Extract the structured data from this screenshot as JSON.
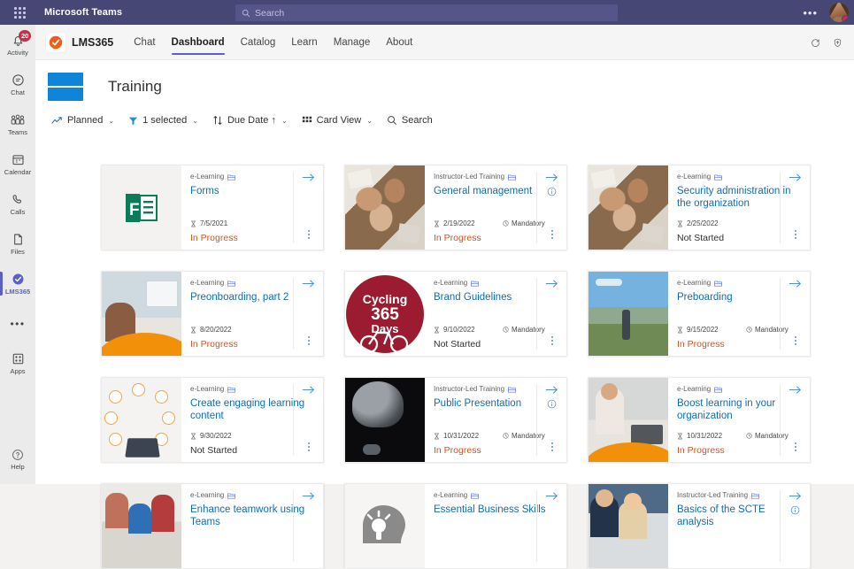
{
  "topbar": {
    "app_title": "Microsoft Teams",
    "search_placeholder": "Search",
    "search_value": "",
    "more_label": "•••"
  },
  "rail": {
    "items": [
      {
        "label": "Activity",
        "icon": "activity-bell-icon",
        "badge": "20"
      },
      {
        "label": "Chat",
        "icon": "chat-bubble-icon",
        "badge": ""
      },
      {
        "label": "Teams",
        "icon": "teams-people-icon",
        "badge": ""
      },
      {
        "label": "Calendar",
        "icon": "calendar-icon",
        "badge": ""
      },
      {
        "label": "Calls",
        "icon": "phone-icon",
        "badge": ""
      },
      {
        "label": "Files",
        "icon": "file-icon",
        "badge": ""
      },
      {
        "label": "LMS365",
        "icon": "lms365-check-icon",
        "badge": ""
      }
    ],
    "more_label": "•••",
    "help_label": "Help"
  },
  "app_header": {
    "name": "LMS365",
    "tabs": [
      {
        "label": "Chat",
        "active": false
      },
      {
        "label": "Dashboard",
        "active": true
      },
      {
        "label": "Catalog",
        "active": false
      },
      {
        "label": "Learn",
        "active": false
      },
      {
        "label": "Manage",
        "active": false
      },
      {
        "label": "About",
        "active": false
      }
    ],
    "refresh_icon": "refresh-icon",
    "shield_icon": "shield-info-icon"
  },
  "page": {
    "title": "Training",
    "menu_button_icon": "hamburger-menu-icon"
  },
  "toolbar": {
    "view": {
      "label": "Planned",
      "icon": "trending-line-icon",
      "caret": "⌄"
    },
    "filter": {
      "label": "1 selected",
      "icon": "filter-funnel-icon",
      "caret": "⌄"
    },
    "sort": {
      "label": "Due Date ↑",
      "icon": "sort-arrows-icon",
      "caret": "⌄"
    },
    "layout": {
      "label": "Card View",
      "icon": "grid-view-icon",
      "caret": "⌄"
    },
    "search": {
      "label": "Search",
      "icon": "search-icon"
    }
  },
  "colors": {
    "teams_purple": "#464775",
    "accent_blue": "#0f6cbd",
    "hamburger_blue": "#0f84d9",
    "in_progress": "#d9511a",
    "badge_red": "#c4314b"
  },
  "cards": [
    {
      "type": "e-Learning",
      "title": "Forms",
      "date": "7/5/2021",
      "mandatory": "",
      "status": "In Progress",
      "status_kind": "inprogress",
      "thumb": "forms-logo-thumbnail",
      "info": false
    },
    {
      "type": "Instructor-Led Training",
      "title": "General management",
      "date": "2/19/2022",
      "mandatory": "Mandatory",
      "status": "In Progress",
      "status_kind": "inprogress",
      "thumb": "hands-teamwork-thumbnail",
      "info": true
    },
    {
      "type": "e-Learning",
      "title": "Security administration in the organization",
      "date": "2/25/2022",
      "mandatory": "",
      "status": "Not Started",
      "status_kind": "notstarted",
      "thumb": "hands-teamwork-thumbnail",
      "info": false
    },
    {
      "type": "e-Learning",
      "title": "Preonboarding, part 2",
      "date": "8/20/2022",
      "mandatory": "",
      "status": "In Progress",
      "status_kind": "inprogress",
      "thumb": "office-meeting-thumbnail",
      "info": false
    },
    {
      "type": "e-Learning",
      "title": "Brand Guidelines",
      "date": "9/10/2022",
      "mandatory": "Mandatory",
      "status": "Not Started",
      "status_kind": "notstarted",
      "thumb": "cycling-365-days-logo-thumbnail",
      "info": false
    },
    {
      "type": "e-Learning",
      "title": "Preboarding",
      "date": "9/15/2022",
      "mandatory": "Mandatory",
      "status": "In Progress",
      "status_kind": "inprogress",
      "thumb": "mountain-cyclist-thumbnail",
      "info": false
    },
    {
      "type": "e-Learning",
      "title": "Create engaging learning content",
      "date": "9/30/2022",
      "mandatory": "",
      "status": "Not Started",
      "status_kind": "notstarted",
      "thumb": "network-people-laptop-thumbnail",
      "info": false
    },
    {
      "type": "Instructor-Led Training",
      "title": "Public Presentation",
      "date": "10/31/2022",
      "mandatory": "Mandatory",
      "status": "In Progress",
      "status_kind": "inprogress",
      "thumb": "microphone-thumbnail",
      "info": true
    },
    {
      "type": "e-Learning",
      "title": "Boost learning in your organization",
      "date": "10/31/2022",
      "mandatory": "Mandatory",
      "status": "In Progress",
      "status_kind": "inprogress",
      "thumb": "man-with-laptop-thumbnail",
      "info": false
    },
    {
      "type": "e-Learning",
      "title": "Enhance teamwork using Teams",
      "date": "",
      "mandatory": "",
      "status": "",
      "status_kind": "notstarted",
      "thumb": "team-whiteboard-thumbnail",
      "info": false
    },
    {
      "type": "e-Learning",
      "title": "Essential Business Skills",
      "date": "",
      "mandatory": "",
      "status": "",
      "status_kind": "notstarted",
      "thumb": "lightbulb-head-thumbnail",
      "info": false
    },
    {
      "type": "Instructor-Led Training",
      "title": "Basics of the SCTE analysis",
      "date": "",
      "mandatory": "",
      "status": "",
      "status_kind": "notstarted",
      "thumb": "business-people-thumbnail",
      "info": true
    }
  ],
  "card_icons": {
    "type_icon": "course-folder-icon",
    "date_icon": "hourglass-icon",
    "mandatory_icon": "clock-mandatory-icon",
    "open_icon": "arrow-right-icon",
    "info_icon": "info-circle-icon",
    "more_icon": "kebab-menu-icon"
  }
}
